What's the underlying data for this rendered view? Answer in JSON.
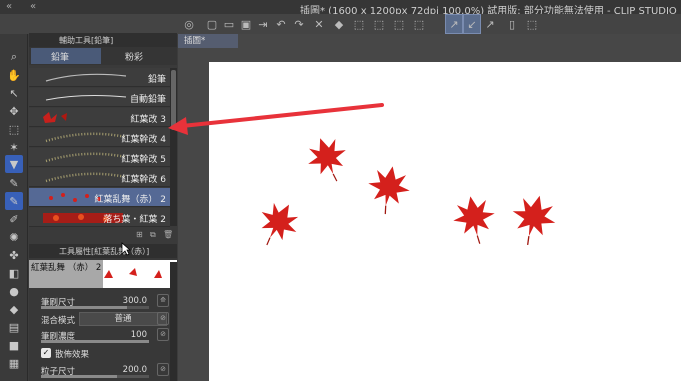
{
  "window": {
    "title": "插圖* (1600 x 1200px 72dpi 100.0%) 試用版: 部分功能無法使用 - CLIP STUDIO PAINT"
  },
  "sub_tool_panel": {
    "header": "輔助工具[鉛筆]",
    "tabs": [
      {
        "label": "鉛筆"
      },
      {
        "label": "粉彩"
      }
    ],
    "brushes": [
      {
        "label": "鉛筆"
      },
      {
        "label": "自動鉛筆"
      },
      {
        "label": "紅葉改 3"
      },
      {
        "label": "紅葉幹改 4"
      },
      {
        "label": "紅葉幹改 5"
      },
      {
        "label": "紅葉幹改 6"
      },
      {
        "label": "紅葉乱舞（赤） 2"
      },
      {
        "label": "落ち葉・紅葉 2"
      }
    ],
    "selected_index": 6
  },
  "tool_property": {
    "header": "工具屬性[紅葉乱舞（赤）]",
    "preview_label": "紅葉乱舞 （赤） 2",
    "brush_size": {
      "label": "筆刷尺寸",
      "value": "300.0",
      "fraction": 0.8
    },
    "blend_mode": {
      "label": "混合模式",
      "value": "普通"
    },
    "brush_density": {
      "label": "筆刷濃度",
      "value": "100",
      "fraction": 1.0
    },
    "scatter": {
      "label": "散佈效果",
      "checked": true
    },
    "particle_size": {
      "label": "粒子尺寸",
      "value": "200.0",
      "fraction": 0.7
    }
  },
  "document_tab": {
    "label": "插圖*"
  },
  "colors": {
    "accent": "#3860b8",
    "arrow": "#e8323a",
    "leaf": "#d4201c"
  }
}
